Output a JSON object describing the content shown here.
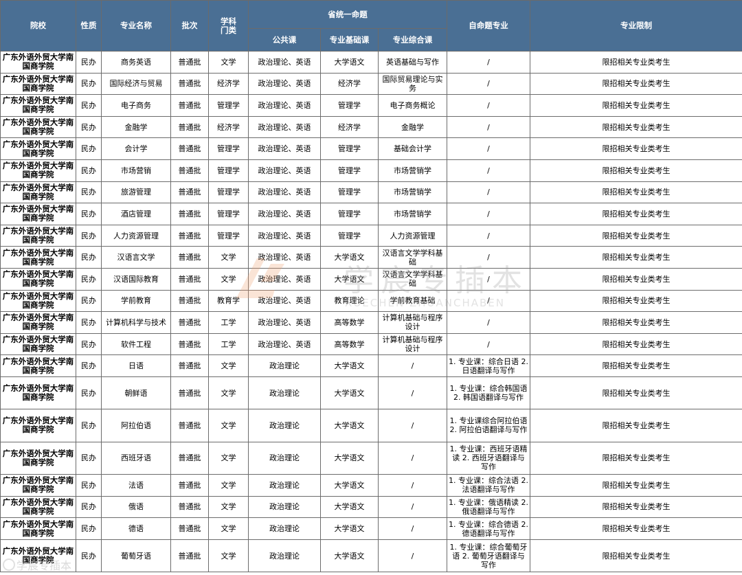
{
  "table": {
    "headers": {
      "school": "院校",
      "nature": "性质",
      "major": "专业名称",
      "batch": "批次",
      "category": "学科\n门类",
      "unified_group": "省统一命题",
      "public_course": "公共课",
      "basic_course": "专业基础课",
      "comprehensive_course": "专业综合课",
      "custom_major": "自命题专业",
      "restriction": "专业限制"
    },
    "rows": [
      {
        "school": "广东外语外贸大学南国商学院",
        "nature": "民办",
        "major": "商务英语",
        "batch": "普通批",
        "category": "文学",
        "public": "政治理论、英语",
        "basic": "大学语文",
        "comprehensive": "英语基础与写作",
        "custom": "/",
        "restriction": "限招相关专业类考生"
      },
      {
        "school": "广东外语外贸大学南国商学院",
        "nature": "民办",
        "major": "国际经济与贸易",
        "batch": "普通批",
        "category": "经济学",
        "public": "政治理论、英语",
        "basic": "经济学",
        "comprehensive": "国际贸易理论与实务",
        "custom": "/",
        "restriction": "限招相关专业类考生"
      },
      {
        "school": "广东外语外贸大学南国商学院",
        "nature": "民办",
        "major": "电子商务",
        "batch": "普通批",
        "category": "管理学",
        "public": "政治理论、英语",
        "basic": "管理学",
        "comprehensive": "电子商务概论",
        "custom": "/",
        "restriction": "限招相关专业类考生"
      },
      {
        "school": "广东外语外贸大学南国商学院",
        "nature": "民办",
        "major": "金融学",
        "batch": "普通批",
        "category": "经济学",
        "public": "政治理论、英语",
        "basic": "经济学",
        "comprehensive": "金融学",
        "custom": "/",
        "restriction": "限招相关专业类考生"
      },
      {
        "school": "广东外语外贸大学南国商学院",
        "nature": "民办",
        "major": "会计学",
        "batch": "普通批",
        "category": "管理学",
        "public": "政治理论、英语",
        "basic": "管理学",
        "comprehensive": "基础会计学",
        "custom": "/",
        "restriction": "限招相关专业类考生"
      },
      {
        "school": "广东外语外贸大学南国商学院",
        "nature": "民办",
        "major": "市场营销",
        "batch": "普通批",
        "category": "管理学",
        "public": "政治理论、英语",
        "basic": "管理学",
        "comprehensive": "市场营销学",
        "custom": "/",
        "restriction": "限招相关专业类考生"
      },
      {
        "school": "广东外语外贸大学南国商学院",
        "nature": "民办",
        "major": "旅游管理",
        "batch": "普通批",
        "category": "管理学",
        "public": "政治理论、英语",
        "basic": "管理学",
        "comprehensive": "市场营销学",
        "custom": "/",
        "restriction": "限招相关专业类考生"
      },
      {
        "school": "广东外语外贸大学南国商学院",
        "nature": "民办",
        "major": "酒店管理",
        "batch": "普通批",
        "category": "管理学",
        "public": "政治理论、英语",
        "basic": "管理学",
        "comprehensive": "市场营销学",
        "custom": "/",
        "restriction": "限招相关专业类考生"
      },
      {
        "school": "广东外语外贸大学南国商学院",
        "nature": "民办",
        "major": "人力资源管理",
        "batch": "普通批",
        "category": "管理学",
        "public": "政治理论、英语",
        "basic": "管理学",
        "comprehensive": "人力资源管理",
        "custom": "/",
        "restriction": "限招相关专业类考生"
      },
      {
        "school": "广东外语外贸大学南国商学院",
        "nature": "民办",
        "major": "汉语言文学",
        "batch": "普通批",
        "category": "文学",
        "public": "政治理论、英语",
        "basic": "大学语文",
        "comprehensive": "汉语言文学学科基础",
        "custom": "/",
        "restriction": "限招相关专业类考生"
      },
      {
        "school": "广东外语外贸大学南国商学院",
        "nature": "民办",
        "major": "汉语国际教育",
        "batch": "普通批",
        "category": "文学",
        "public": "政治理论、英语",
        "basic": "大学语文",
        "comprehensive": "汉语言文学学科基础",
        "custom": "/",
        "restriction": "限招相关专业类考生"
      },
      {
        "school": "广东外语外贸大学南国商学院",
        "nature": "民办",
        "major": "学前教育",
        "batch": "普通批",
        "category": "教育学",
        "public": "政治理论、英语",
        "basic": "教育理论",
        "comprehensive": "学前教育基础",
        "custom": "/",
        "restriction": "限招相关专业类考生"
      },
      {
        "school": "广东外语外贸大学南国商学院",
        "nature": "民办",
        "major": "计算机科学与技术",
        "batch": "普通批",
        "category": "工学",
        "public": "政治理论、英语",
        "basic": "高等数学",
        "comprehensive": "计算机基础与程序设计",
        "custom": "/",
        "restriction": "限招相关专业类考生"
      },
      {
        "school": "广东外语外贸大学南国商学院",
        "nature": "民办",
        "major": "软件工程",
        "batch": "普通批",
        "category": "工学",
        "public": "政治理论、英语",
        "basic": "高等数学",
        "comprehensive": "计算机基础与程序设计",
        "custom": "/",
        "restriction": "限招相关专业类考生"
      },
      {
        "school": "广东外语外贸大学南国商学院",
        "nature": "民办",
        "major": "日语",
        "batch": "普通批",
        "category": "文学",
        "public": "政治理论",
        "basic": "大学语文",
        "comprehensive": "/",
        "custom": "1. 专业课：综合日语 2. 日语翻译与写作",
        "restriction": "限招相关专业类考生"
      },
      {
        "school": "广东外语外贸大学南国商学院",
        "nature": "民办",
        "major": "朝鲜语",
        "batch": "普通批",
        "category": "文学",
        "public": "政治理论",
        "basic": "大学语文",
        "comprehensive": "/",
        "custom": "1. 专业课：综合韩国语 2. 韩国语翻译与写作",
        "restriction": "限招相关专业类考生"
      },
      {
        "school": "广东外语外贸大学南国商学院",
        "nature": "民办",
        "major": "阿拉伯语",
        "batch": "普通批",
        "category": "文学",
        "public": "政治理论",
        "basic": "大学语文",
        "comprehensive": "/",
        "custom": "1. 专业课综合阿拉伯语 2. 阿拉伯语翻译与写作",
        "restriction": "限招相关专业类考生"
      },
      {
        "school": "广东外语外贸大学南国商学院",
        "nature": "民办",
        "major": "西班牙语",
        "batch": "普通批",
        "category": "文学",
        "public": "政治理论",
        "basic": "大学语文",
        "comprehensive": "/",
        "custom": "1. 专业课：西班牙语精读 2. 西班牙语翻译与写作",
        "restriction": "限招相关专业类考生"
      },
      {
        "school": "广东外语外贸大学南国商学院",
        "nature": "民办",
        "major": "法语",
        "batch": "普通批",
        "category": "文学",
        "public": "政治理论",
        "basic": "大学语文",
        "comprehensive": "/",
        "custom": "1. 专业课：综合法语 2. 法语翻译与写作",
        "restriction": "限招相关专业类考生"
      },
      {
        "school": "广东外语外贸大学南国商学院",
        "nature": "民办",
        "major": "俄语",
        "batch": "普通批",
        "category": "文学",
        "public": "政治理论",
        "basic": "大学语文",
        "comprehensive": "/",
        "custom": "1. 专业课：俄语精读 2. 俄语翻译与写作",
        "restriction": "限招相关专业类考生"
      },
      {
        "school": "广东外语外贸大学南国商学院",
        "nature": "民办",
        "major": "德语",
        "batch": "普通批",
        "category": "文学",
        "public": "政治理论",
        "basic": "大学语文",
        "comprehensive": "/",
        "custom": "1. 专业课：综合德语 2. 德语翻译与写作",
        "restriction": "限招相关专业类考生"
      },
      {
        "school": "广东外语外贸大学南国商学院",
        "nature": "民办",
        "major": "葡萄牙语",
        "batch": "普通批",
        "category": "文学",
        "public": "政治理论",
        "basic": "大学语文",
        "comprehensive": "/",
        "custom": "1. 专业课：综合葡萄牙语 2. 葡萄牙语翻译与写作",
        "restriction": "限招相关专业类考生"
      }
    ]
  },
  "watermark": {
    "cn": "学宸专插本",
    "en": "XUECHEN ZHUANCHABEN",
    "corner": "学宸专插本"
  },
  "colors": {
    "header_bg": "#4a6f94",
    "header_text": "#ffffff",
    "border": "#6b6b6b",
    "watermark_logo": "#f0a070"
  }
}
